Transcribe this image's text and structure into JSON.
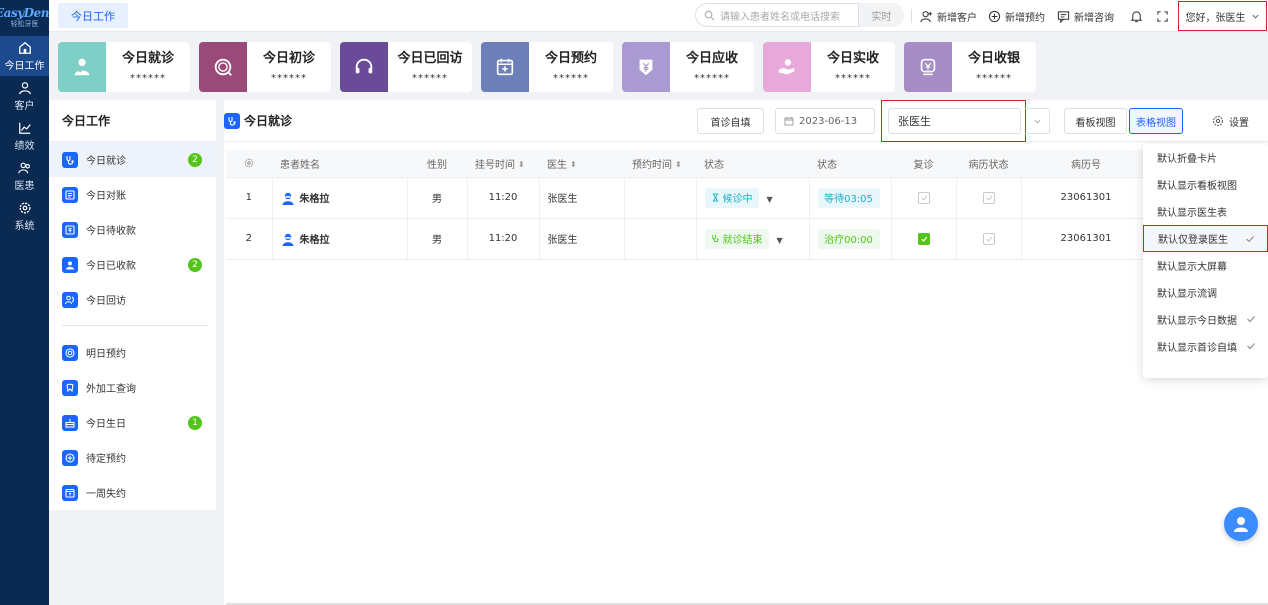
{
  "app": {
    "logo_text": "EasyDent",
    "logo_sub": "轻松牙医",
    "accent": "#1a66ff"
  },
  "leftnav": [
    {
      "label": "今日工作",
      "icon": "home-icon",
      "active": true
    },
    {
      "label": "客户",
      "icon": "user-icon"
    },
    {
      "label": "绩效",
      "icon": "chart-icon"
    },
    {
      "label": "医患",
      "icon": "users-icon"
    },
    {
      "label": "系统",
      "icon": "gear-icon"
    }
  ],
  "topbar": {
    "tab_label": "今日工作",
    "search_placeholder": "请输入患者姓名或电话搜索",
    "realtime_label": "实时",
    "add_customer": "新增客户",
    "add_appointment": "新增预约",
    "add_consult": "新增咨询",
    "greeting": "您好，张医生"
  },
  "cards": [
    {
      "title": "今日就诊",
      "value": "******",
      "color": "#7fcfc7",
      "icon": "doctor-icon"
    },
    {
      "title": "今日初诊",
      "value": "******",
      "color": "#9a4a78",
      "icon": "first-visit-icon"
    },
    {
      "title": "今日已回访",
      "value": "******",
      "color": "#6a4b98",
      "icon": "headset-icon"
    },
    {
      "title": "今日预约",
      "value": "******",
      "color": "#6d7fb8",
      "icon": "calendar-plus-icon"
    },
    {
      "title": "今日应收",
      "value": "******",
      "color": "#a99bd1",
      "icon": "yen-icon"
    },
    {
      "title": "今日实收",
      "value": "******",
      "color": "#e6a9d9",
      "icon": "hand-coin-icon"
    },
    {
      "title": "今日收银",
      "value": "******",
      "color": "#a78dc6",
      "icon": "cashier-icon"
    }
  ],
  "leftpanel": {
    "title": "今日工作",
    "items": [
      {
        "label": "今日就诊",
        "badge": "2",
        "active": true,
        "icon": "stethoscope-icon"
      },
      {
        "label": "今日对账",
        "badge": "",
        "icon": "ledger-icon"
      },
      {
        "label": "今日待收款",
        "badge": "",
        "icon": "pending-payment-icon"
      },
      {
        "label": "今日已收款",
        "badge": "2",
        "icon": "paid-icon"
      },
      {
        "label": "今日回访",
        "badge": "",
        "icon": "return-visit-icon"
      }
    ],
    "items2": [
      {
        "label": "明日预约",
        "badge": "",
        "icon": "tomorrow-appointment-icon"
      },
      {
        "label": "外加工查询",
        "badge": "",
        "icon": "outsource-icon"
      },
      {
        "label": "今日生日",
        "badge": "1",
        "icon": "cake-icon"
      },
      {
        "label": "待定预约",
        "badge": "",
        "icon": "pending-appointment-icon"
      },
      {
        "label": "一周失约",
        "badge": "",
        "icon": "missed-week-icon"
      }
    ]
  },
  "main": {
    "title": "今日就诊",
    "first_visit_btn": "首诊自填",
    "date": "2023-06-13",
    "doctor_select": "张医生",
    "board_view": "看板视图",
    "table_view": "表格视图",
    "settings": "设置"
  },
  "table": {
    "headers": [
      "患者姓名",
      "性别",
      "挂号时间",
      "医生",
      "预约时间",
      "状态",
      "状态",
      "复诊",
      "病历状态",
      "病历号"
    ],
    "rows": [
      {
        "idx": "1",
        "name": "朱格拉",
        "gender": "男",
        "reg_time": "11:20",
        "doctor": "张医生",
        "appt_time": "",
        "status": "候诊中",
        "status2": "等待03:05",
        "revisit": false,
        "record_status": true,
        "record_no": "23061301"
      },
      {
        "idx": "2",
        "name": "朱格拉",
        "gender": "男",
        "reg_time": "11:20",
        "doctor": "张医生",
        "appt_time": "",
        "status": "就诊结束",
        "status2": "治疗00:00",
        "revisit": true,
        "record_status": true,
        "record_no": "23061301"
      }
    ]
  },
  "settings_menu": [
    {
      "label": "默认折叠卡片",
      "checked": false
    },
    {
      "label": "默认显示看板视图",
      "checked": false
    },
    {
      "label": "默认显示医生表",
      "checked": false
    },
    {
      "label": "默认仅登录医生",
      "checked": true
    },
    {
      "label": "默认显示大屏幕",
      "checked": false
    },
    {
      "label": "默认显示流调",
      "checked": false
    },
    {
      "label": "默认显示今日数据",
      "checked": true
    },
    {
      "label": "默认显示首诊自填",
      "checked": true
    }
  ]
}
